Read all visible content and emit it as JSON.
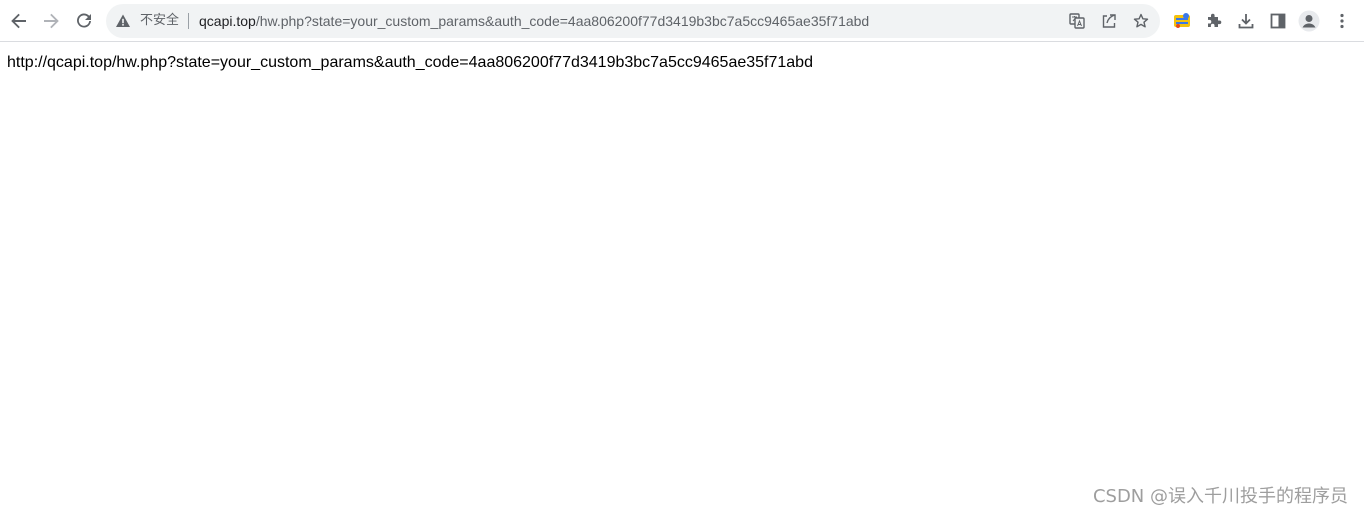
{
  "browser": {
    "address_bar": {
      "security_label": "不安全",
      "url_host": "qcapi.top",
      "url_rest": "/hw.php?state=your_custom_params&auth_code=4aa806200f77d3419b3bc7a5cc9465ae35f71abd"
    },
    "icons": {
      "back": "back-arrow-icon",
      "forward": "forward-arrow-icon",
      "reload": "reload-icon",
      "warning": "warning-icon",
      "translate": "translate-icon",
      "share": "share-icon",
      "bookmark": "star-icon",
      "extension_colored": "extension-app-icon",
      "extensions": "puzzle-icon",
      "downloads": "download-icon",
      "side_panel": "side-panel-icon",
      "profile": "profile-avatar-icon",
      "menu": "kebab-menu-icon"
    }
  },
  "page": {
    "body_text": "http://qcapi.top/hw.php?state=your_custom_params&auth_code=4aa806200f77d3419b3bc7a5cc9465ae35f71abd"
  },
  "watermark": {
    "text": "CSDN @误入千川投手的程序员"
  },
  "colors": {
    "omnibox_bg": "#f1f3f4",
    "icon": "#5f6368",
    "watermark": "#9e9e9e"
  }
}
